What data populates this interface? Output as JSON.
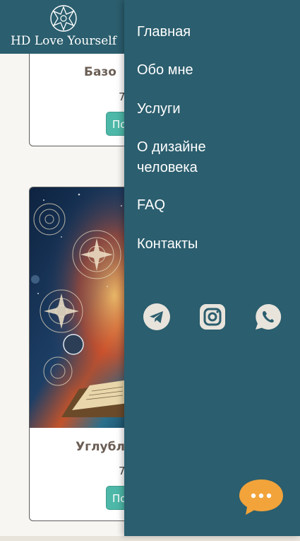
{
  "header": {
    "logo_text": "HD Love Yourself",
    "logo_icon": "mandala-star-icon"
  },
  "cards": [
    {
      "title": "Базо",
      "price": "7",
      "button_label": "По"
    },
    {
      "title": "Углубл",
      "price": "7",
      "button_label": "По",
      "image": "cosmic-book-illustration"
    }
  ],
  "drawer": {
    "menu": [
      {
        "label": "Главная"
      },
      {
        "label": "Обо мне"
      },
      {
        "label": "Услуги"
      },
      {
        "label": "О дизайне\nчеловека"
      },
      {
        "label": "FAQ"
      },
      {
        "label": "Контакты"
      }
    ],
    "social": [
      "telegram-icon",
      "instagram-icon",
      "whatsapp-icon"
    ],
    "chat": "chat-bubble-icon"
  },
  "colors": {
    "primary": "#2b5e6e",
    "accent": "#4db8a8",
    "chat": "#f2a33a",
    "icon_bg": "#e8e4dc"
  }
}
